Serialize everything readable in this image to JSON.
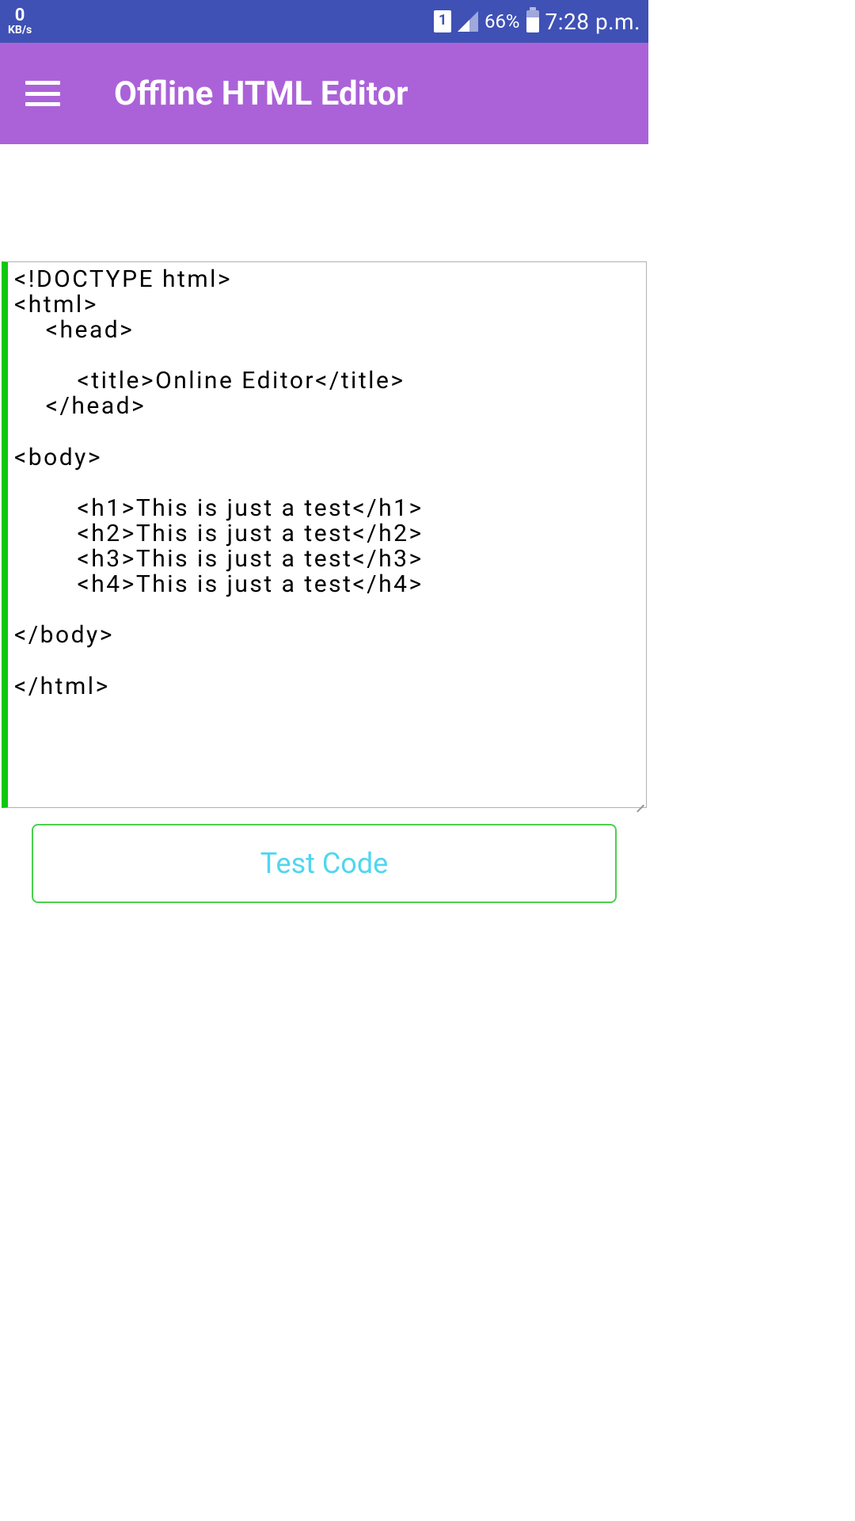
{
  "status_bar": {
    "speed_value": "0",
    "speed_unit": "KB/s",
    "battery_percent": "66%",
    "time": "7:28 p.m."
  },
  "app_bar": {
    "title": "Offline HTML Editor"
  },
  "editor": {
    "content": "<!DOCTYPE html>\n<html>\n    <head>\n\n        <title>Online Editor</title>\n    </head>\n\n<body>\n\n        <h1>This is just a test</h1>\n        <h2>This is just a test</h2>\n        <h3>This is just a test</h3>\n        <h4>This is just a test</h4>\n\n</body>\n\n</html>"
  },
  "buttons": {
    "test_code_label": "Test Code"
  }
}
